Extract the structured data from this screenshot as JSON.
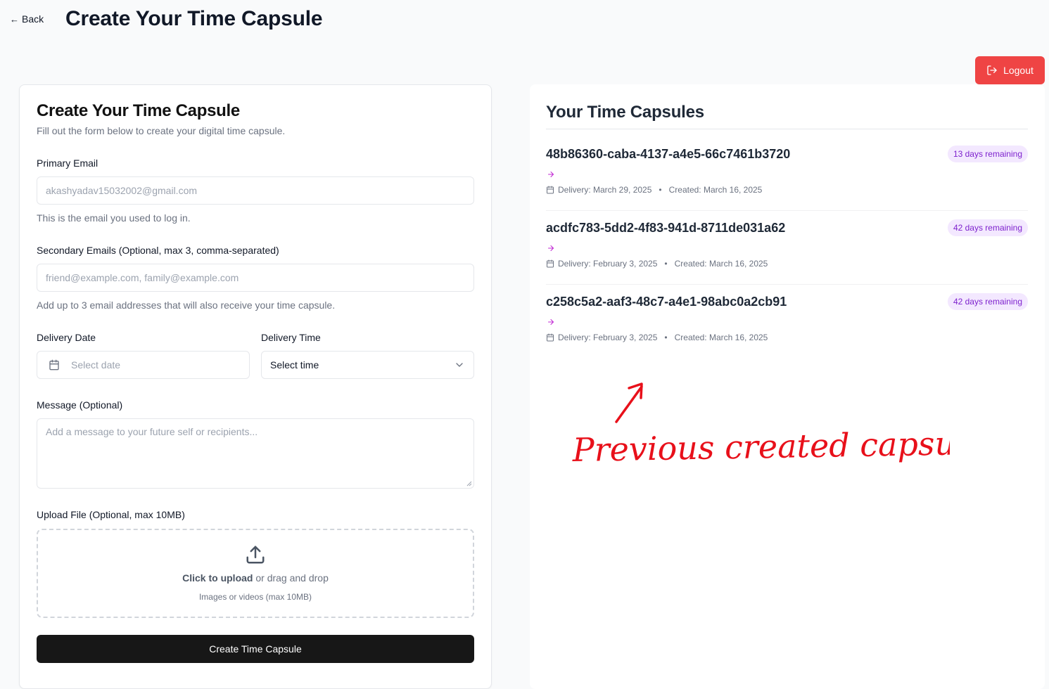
{
  "header": {
    "back_label": "Back",
    "back_arrow": "←",
    "title": "Create Your Time Capsule",
    "logout_label": "Logout"
  },
  "form": {
    "title": "Create Your Time Capsule",
    "subtitle": "Fill out the form below to create your digital time capsule.",
    "primary_email": {
      "label": "Primary Email",
      "value": "akashyadav15032002@gmail.com",
      "help": "This is the email you used to log in."
    },
    "secondary_emails": {
      "label": "Secondary Emails (Optional, max 3, comma-separated)",
      "placeholder": "friend@example.com, family@example.com",
      "help": "Add up to 3 email addresses that will also receive your time capsule."
    },
    "delivery_date": {
      "label": "Delivery Date",
      "placeholder": "Select date",
      "icon": "calendar-icon"
    },
    "delivery_time": {
      "label": "Delivery Time",
      "selected": "Select time",
      "icon": "chevron-down-icon"
    },
    "message": {
      "label": "Message (Optional)",
      "placeholder": "Add a message to your future self or recipients..."
    },
    "upload": {
      "label": "Upload File (Optional, max 10MB)",
      "click_text": "Click to upload",
      "rest_text": " or drag and drop",
      "hint": "Images or videos (max 10MB)",
      "icon": "upload-icon"
    },
    "submit_label": "Create Time Capsule"
  },
  "capsules": {
    "title": "Your Time Capsules",
    "items": [
      {
        "id": "48b86360-caba-4137-a4e5-66c7461b3720",
        "badge": "13 days remaining",
        "delivery": "Delivery: March 29, 2025",
        "separator": "•",
        "created": "Created: March 16, 2025"
      },
      {
        "id": "acdfc783-5dd2-4f83-941d-8711de031a62",
        "badge": "42 days remaining",
        "delivery": "Delivery: February 3, 2025",
        "separator": "•",
        "created": "Created: March 16, 2025"
      },
      {
        "id": "c258c5a2-aaf3-48c7-a4e1-98abc0a2cb91",
        "badge": "42 days remaining",
        "delivery": "Delivery: February 3, 2025",
        "separator": "•",
        "created": "Created: March 16, 2025"
      }
    ]
  },
  "annotation": {
    "text": "Previous created capsules",
    "color": "#e8101a"
  },
  "colors": {
    "background": "#f9fafb",
    "logout": "#ef4444",
    "submit": "#171717",
    "badge_bg": "#f3e8ff",
    "badge_text": "#7e22ce",
    "accent_arrow": "#c026d3"
  }
}
